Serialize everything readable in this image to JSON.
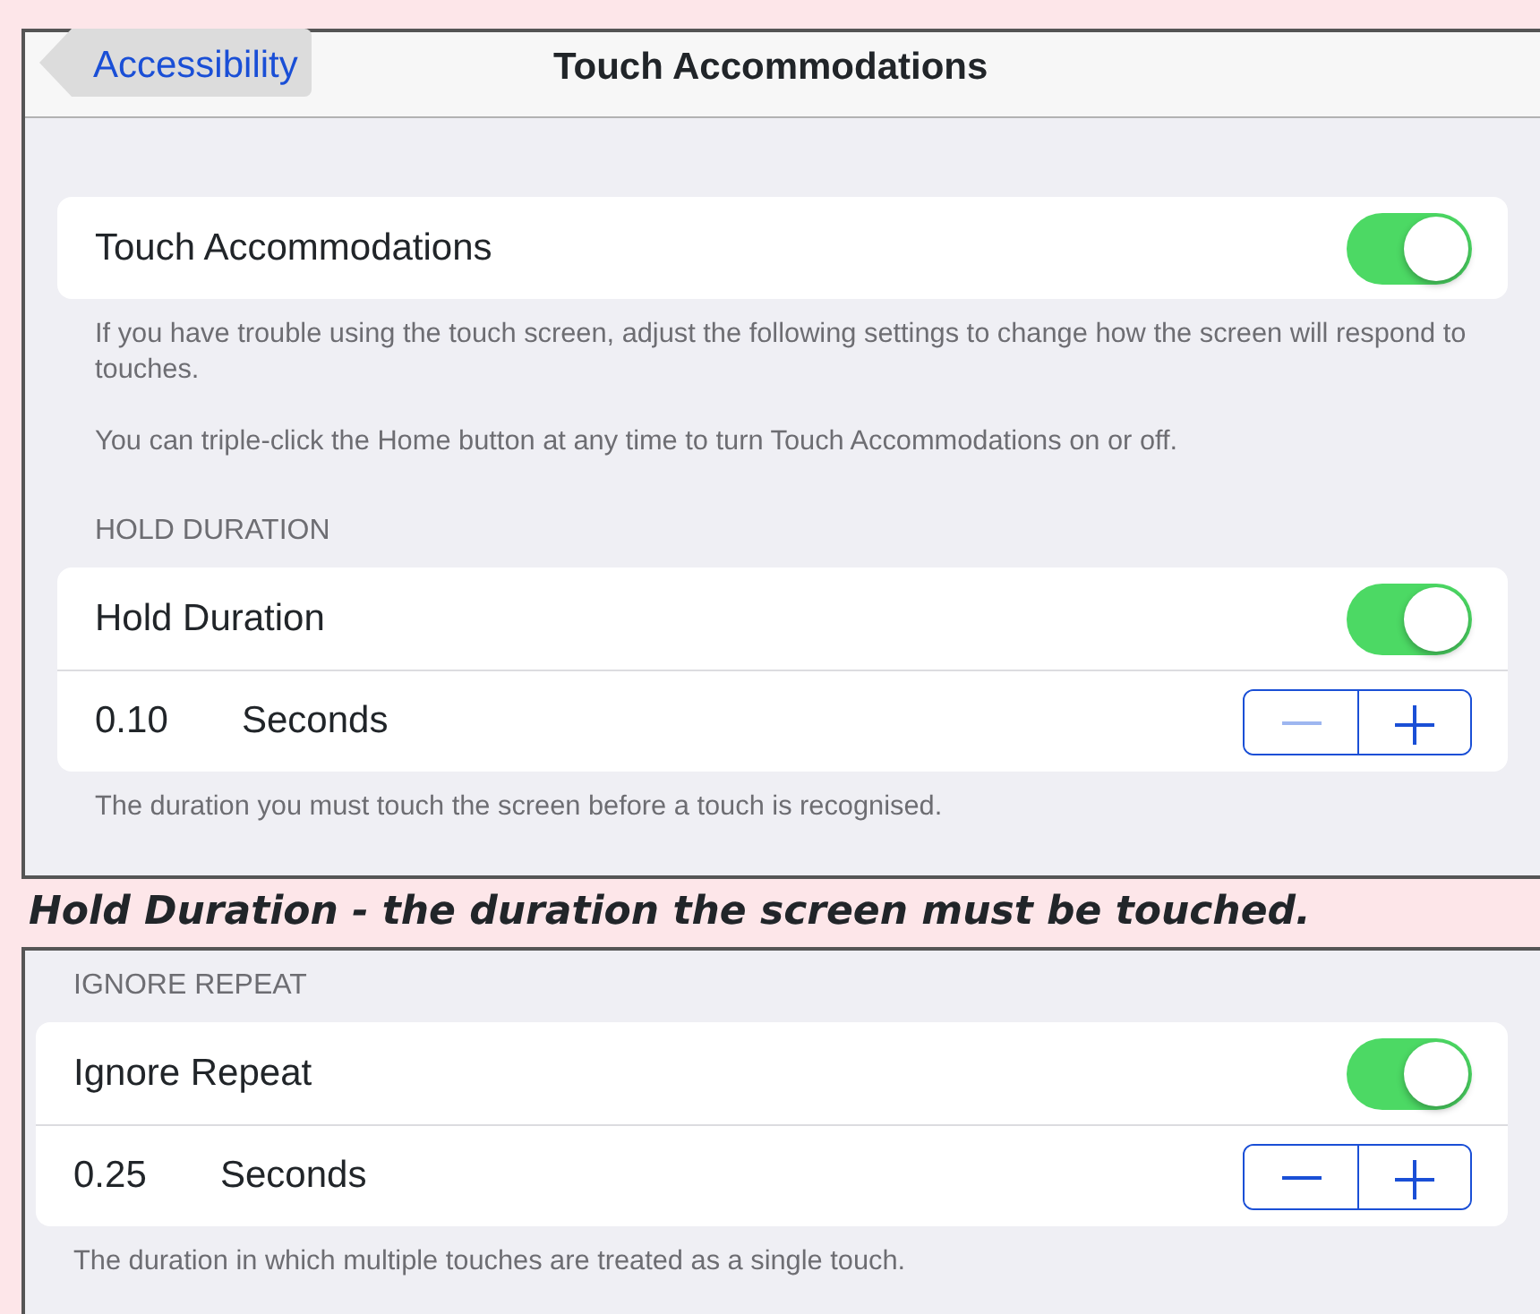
{
  "screenshots": [
    {
      "nav": {
        "back": "Accessibility",
        "title": "Touch Accommodations"
      },
      "sections": [
        {
          "rows": [
            {
              "kind": "switch",
              "label": "Touch Accommodations",
              "on": true
            }
          ],
          "footer": [
            "If you have trouble using the touch screen, adjust the following settings to change how the screen will respond to touches.",
            "You can triple-click the Home button at any time to turn Touch Accommodations on or off."
          ]
        },
        {
          "header": "HOLD DURATION",
          "rows": [
            {
              "kind": "switch",
              "label": "Hold Duration",
              "on": true
            },
            {
              "kind": "stepper",
              "value": "0.10",
              "unit": "Seconds",
              "decrement_disabled": true,
              "increment_disabled": false
            }
          ],
          "footer": [
            "The duration you must touch the screen before a touch is recognised."
          ]
        }
      ]
    },
    {
      "sections": [
        {
          "header": "IGNORE REPEAT",
          "rows": [
            {
              "kind": "switch",
              "label": "Ignore Repeat",
              "on": true
            },
            {
              "kind": "stepper",
              "value": "0.25",
              "unit": "Seconds",
              "decrement_disabled": false,
              "increment_disabled": false
            }
          ],
          "footer": [
            "The duration in which multiple touches are treated as a single touch."
          ]
        }
      ]
    }
  ],
  "captions": [
    "Hold Duration - the duration the screen must be touched."
  ]
}
